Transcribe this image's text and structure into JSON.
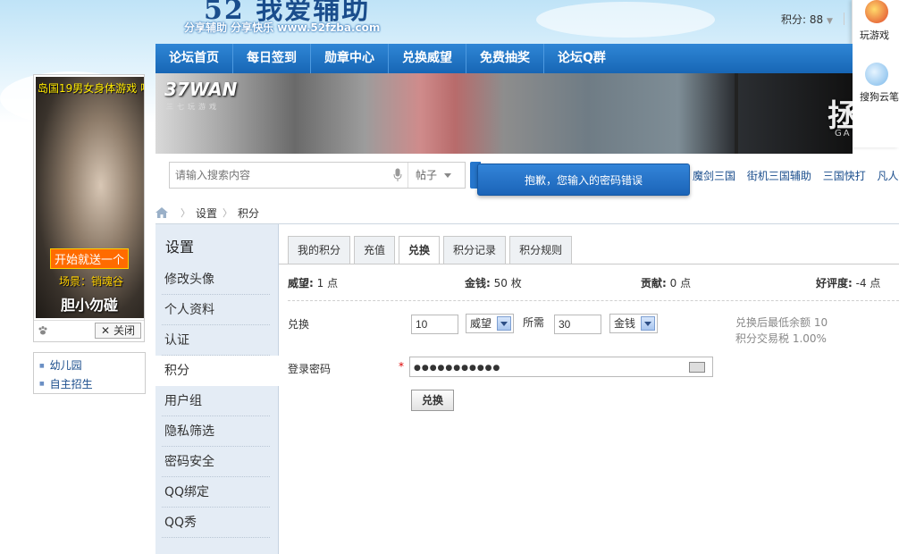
{
  "header": {
    "logo_text": "52 我爱辅助",
    "logo_sub": "分享辅助  分享快乐  www.52fzba.com",
    "points": "积分: 88",
    "side_items": [
      "玩游戏",
      "搜狗云笔"
    ]
  },
  "nav": {
    "items": [
      "论坛首页",
      "每日签到",
      "勋章中心",
      "兑换威望",
      "免费抽奖",
      "论坛Q群"
    ]
  },
  "banner": {
    "brand": "37WAN",
    "brand_sub": "三七玩游戏",
    "game_text": "拯",
    "game_sub": "GA"
  },
  "search": {
    "placeholder": "请输入搜索内容",
    "type": "帖子",
    "hot_links": [
      "魔剑三国",
      "街机三国辅助",
      "三国快打",
      "凡人修真"
    ]
  },
  "toast": {
    "message": "抱歉，您输入的密码错误"
  },
  "breadcrumb": {
    "items": [
      "设置",
      "积分"
    ]
  },
  "ad": {
    "title": "岛国19男女身体游戏 嘿",
    "cta": "开始就送一个",
    "scene": "场景：销魂谷",
    "brand": "胆小勿碰",
    "close": "关闭"
  },
  "side_links": [
    "幼儿园",
    "自主招生"
  ],
  "settings": {
    "title": "设置",
    "items": [
      "修改头像",
      "个人资料",
      "认证",
      "积分",
      "用户组",
      "隐私筛选",
      "密码安全",
      "QQ绑定",
      "QQ秀"
    ],
    "active_index": 3
  },
  "tabs": [
    "我的积分",
    "充值",
    "兑换",
    "积分记录",
    "积分规则"
  ],
  "active_tab": "兑换",
  "stats": [
    {
      "label": "威望:",
      "value": "1 点"
    },
    {
      "label": "金钱:",
      "value": "50 枚"
    },
    {
      "label": "贡献:",
      "value": "0 点"
    },
    {
      "label": "好评度:",
      "value": "-4 点"
    }
  ],
  "exchange": {
    "label": "兑换",
    "amount": "10",
    "from_unit": "威望",
    "need_label": "所需",
    "need_amount": "30",
    "to_unit": "金钱",
    "hint1": "兑换后最低余额 10",
    "hint2": "积分交易税 1.00%",
    "pwd_label": "登录密码",
    "pwd_required": "*",
    "pwd_value": "●●●●●●●●●●●",
    "submit": "兑换"
  },
  "colors": {
    "nav_blue": "#1f78c8",
    "toast_blue": "#2a75c9",
    "link_blue": "#1a4d8c",
    "sidebar_bg": "#e4ecf5"
  }
}
